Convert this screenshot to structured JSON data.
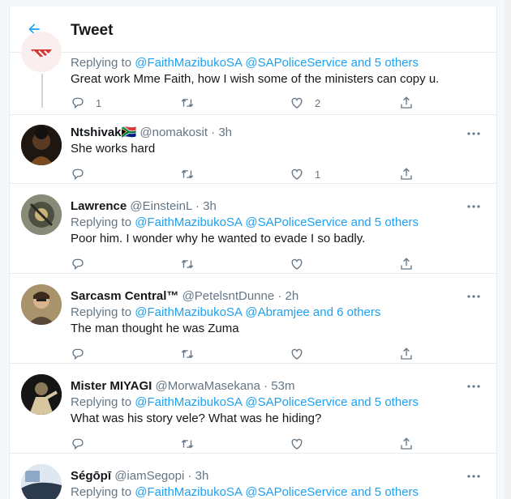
{
  "header": {
    "title": "Tweet"
  },
  "replying_prefix": "Replying to",
  "tweets": [
    {
      "name": "",
      "handle": "",
      "time": "",
      "reply_to": "@FaithMazibukoSA @SAPoliceService and 5 others",
      "text": "Great work Mme Faith, how I wish some of the ministers can copy u.",
      "replies": "1",
      "retweets": "",
      "likes": "2"
    },
    {
      "name": "Ntshivak🇿🇦",
      "handle": "@nomakosit",
      "time": "· 3h",
      "reply_to": "",
      "text": "She works hard",
      "replies": "",
      "retweets": "",
      "likes": "1"
    },
    {
      "name": "Lawrence",
      "handle": "@EinsteinL",
      "time": "· 3h",
      "reply_to": "@FaithMazibukoSA @SAPoliceService and 5 others",
      "text": "Poor him. I wonder why he wanted to evade I so badly.",
      "replies": "",
      "retweets": "",
      "likes": ""
    },
    {
      "name": "Sarcasm Central™",
      "handle": "@PetelsntDunne",
      "time": "· 2h",
      "reply_to": "@FaithMazibukoSA @Abramjee and 6 others",
      "text": "The man thought he was Zuma",
      "replies": "",
      "retweets": "",
      "likes": ""
    },
    {
      "name": "Mister MIYAGI",
      "handle": "@MorwaMasekana",
      "time": "· 53m",
      "reply_to": "@FaithMazibukoSA @SAPoliceService and 5 others",
      "text": "What was his story vele? What was he hiding?",
      "replies": "",
      "retweets": "",
      "likes": ""
    },
    {
      "name": "Ségōpī",
      "handle": "@iamSegopi",
      "time": "· 3h",
      "reply_to": "@FaithMazibukoSA @SAPoliceService and 5 others",
      "text": "",
      "replies": "",
      "retweets": "",
      "likes": ""
    }
  ],
  "colors": {
    "accent": "#1da1f2",
    "muted": "#657786"
  },
  "icons": [
    "back-arrow-icon",
    "reply-icon",
    "retweet-icon",
    "like-icon",
    "share-icon",
    "more-icon"
  ]
}
